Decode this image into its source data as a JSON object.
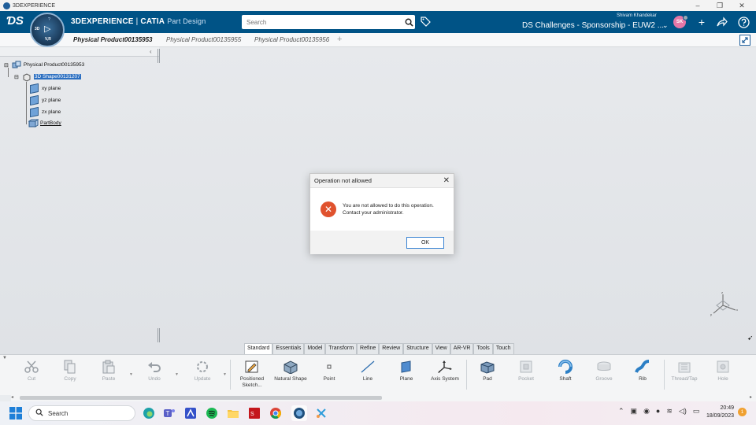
{
  "window": {
    "title": "3DEXPERIENCE"
  },
  "header": {
    "brand": "3DEXPERIENCE",
    "separator": " | ",
    "app": "CATIA",
    "app_sub": "Part Design",
    "compass": {
      "top_label": "?",
      "left_label": "3D",
      "version": "V,R"
    },
    "search_placeholder": "Search",
    "user_name": "Shivam Khandekar",
    "user_initials": "SK",
    "workspace": "DS Challenges - Sponsorship - EUW2 ...",
    "icons": [
      "search-icon",
      "tag-icon",
      "add-icon",
      "share-icon",
      "help-icon"
    ]
  },
  "tabs": [
    {
      "label": "Physical Product00135953",
      "active": true
    },
    {
      "label": "Physical Product00135955",
      "active": false
    },
    {
      "label": "Physical Product00135956",
      "active": false
    }
  ],
  "tree": {
    "root": "Physical Product00135953",
    "shape": "3D Shape00131207",
    "planes": [
      "xy plane",
      "yz plane",
      "zx plane"
    ],
    "body": "PartBody"
  },
  "dialog": {
    "title": "Operation not allowed",
    "message_line1": "You are not allowed to do this operation.",
    "message_line2": "Contact your administrator.",
    "ok_label": "OK"
  },
  "section_tabs": [
    "Standard",
    "Essentials",
    "Model",
    "Transform",
    "Refine",
    "Review",
    "Structure",
    "View",
    "AR-VR",
    "Tools",
    "Touch"
  ],
  "active_section": "Standard",
  "tools": [
    {
      "label": "Cut",
      "enabled": false
    },
    {
      "label": "Copy",
      "enabled": false
    },
    {
      "label": "Paste",
      "enabled": false
    },
    {
      "label": "Undo",
      "enabled": false
    },
    {
      "label": "Update",
      "enabled": false
    },
    {
      "label": "Positioned Sketch...",
      "enabled": true
    },
    {
      "label": "Natural Shape",
      "enabled": true
    },
    {
      "label": "Point",
      "enabled": true
    },
    {
      "label": "Line",
      "enabled": true
    },
    {
      "label": "Plane",
      "enabled": true
    },
    {
      "label": "Axis System",
      "enabled": true
    },
    {
      "label": "Pad",
      "enabled": true
    },
    {
      "label": "Pocket",
      "enabled": false
    },
    {
      "label": "Shaft",
      "enabled": true
    },
    {
      "label": "Groove",
      "enabled": false
    },
    {
      "label": "Rib",
      "enabled": true
    },
    {
      "label": "Thread/Tap",
      "enabled": false
    },
    {
      "label": "Hole",
      "enabled": false
    }
  ],
  "taskbar": {
    "search_label": "Search",
    "time": "20:49",
    "date": "18/09/2023",
    "notification_count": "1"
  },
  "colors": {
    "header": "#005386",
    "error": "#e0522e",
    "selection": "#2c6fc1",
    "accent": "#3a83d2"
  }
}
